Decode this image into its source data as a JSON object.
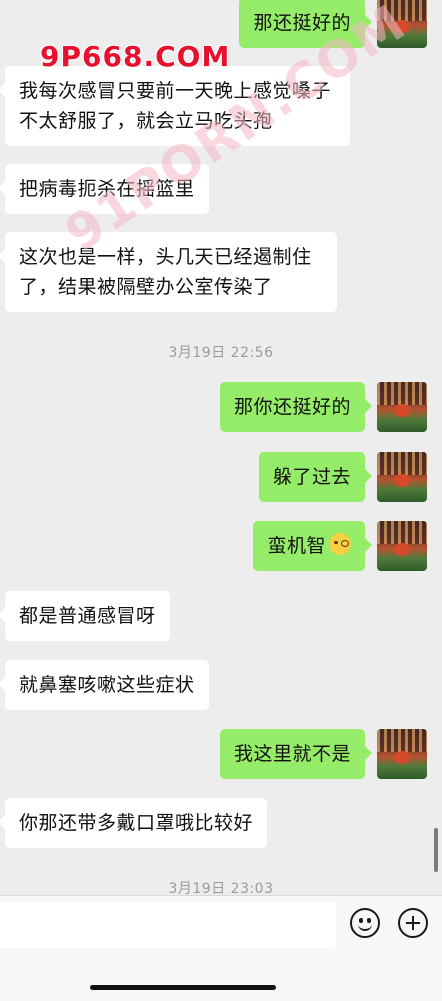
{
  "messages": [
    {
      "side": "right",
      "text": "那还挺好的"
    },
    {
      "side": "left",
      "text": "我每次感冒只要前一天晚上感觉嗓子不太舒服了，就会立马吃头孢"
    },
    {
      "side": "left",
      "text": "把病毒扼杀在摇篮里"
    },
    {
      "side": "left",
      "text": "这次也是一样，头几天已经遏制住了，结果被隔壁办公室传染了"
    },
    {
      "side": "time",
      "text": "3月19日 22:56"
    },
    {
      "side": "right",
      "text": "那你还挺好的"
    },
    {
      "side": "right",
      "text": "躲了过去"
    },
    {
      "side": "right",
      "text": "蛮机智",
      "emoji": "thinking-face"
    },
    {
      "side": "left",
      "text": "都是普通感冒呀"
    },
    {
      "side": "left",
      "text": "就鼻塞咳嗽这些症状"
    },
    {
      "side": "right",
      "text": "我这里就不是"
    },
    {
      "side": "left",
      "text": "你那还带多戴口罩哦比较好"
    },
    {
      "side": "time",
      "text": "3月19日 23:03"
    }
  ],
  "watermarks": [
    "9P668.COM",
    "91PORN.COM"
  ],
  "input": {
    "value": "",
    "placeholder": ""
  },
  "icons": {
    "emoji_button": "smiley-face-icon",
    "more_button": "plus-circle-icon"
  },
  "colors": {
    "background": "#ededed",
    "sent_bubble": "#95ec69",
    "received_bubble": "#ffffff",
    "timestamp": "#9b9b9b"
  }
}
